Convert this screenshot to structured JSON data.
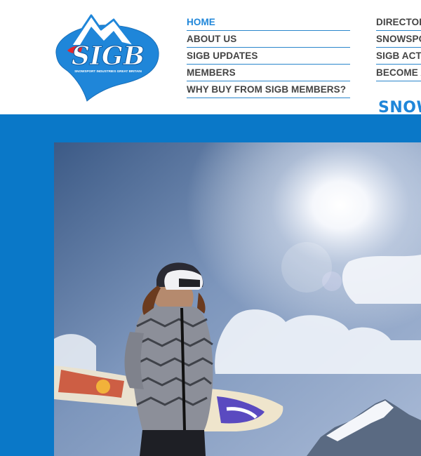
{
  "logo": {
    "wordmark": "SIGB",
    "tagline": "SNOWSPORT INDUSTRIES GREAT BRITAIN"
  },
  "nav_primary": [
    {
      "label": "HOME",
      "active": true
    },
    {
      "label": "ABOUT US",
      "active": false
    },
    {
      "label": "SIGB UPDATES",
      "active": false
    },
    {
      "label": "MEMBERS",
      "active": false
    },
    {
      "label": "WHY BUY FROM SIGB MEMBERS?",
      "active": false
    }
  ],
  "nav_secondary": [
    {
      "label": "DIRECTOR"
    },
    {
      "label": "SNOWSPO"
    },
    {
      "label": "SIGB ACTI"
    },
    {
      "label": "BECOME A"
    }
  ],
  "section_heading": "SNOW",
  "colors": {
    "brand_blue": "#1f86d9",
    "band_blue": "#0a78c8",
    "nav_text": "#444444",
    "accent_red": "#e3262e"
  }
}
